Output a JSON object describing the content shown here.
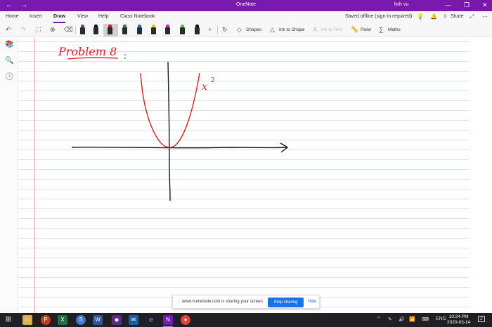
{
  "window": {
    "title": "OneNote",
    "user": "linh vu",
    "back_glyph": "←",
    "forward_glyph": "→",
    "minimize_glyph": "—",
    "restore_glyph": "❐",
    "close_glyph": "✕"
  },
  "menu": {
    "tabs": [
      "Home",
      "Insert",
      "Draw",
      "View",
      "Help",
      "Class Notebook"
    ],
    "active_tab": "Draw",
    "status": "Saved offline (sign-in required)",
    "share_label": "Share"
  },
  "toolbar": {
    "shapes_label": "Shapes",
    "ink_to_shape_label": "Ink to Shape",
    "ink_to_text_label": "Ink to Text",
    "ruler_label": "Ruler",
    "maths_label": "Maths",
    "pens": [
      {
        "name": "pen-purple-tip",
        "color": "#7b3f9e"
      },
      {
        "name": "pen-black",
        "color": "#111111"
      },
      {
        "name": "pen-red",
        "color": "#d11b1b"
      },
      {
        "name": "pen-green",
        "color": "#1f8f3a"
      },
      {
        "name": "pen-blue",
        "color": "#1b6fd1"
      },
      {
        "name": "pen-yellow",
        "color": "#f0c419"
      },
      {
        "name": "pen-magenta",
        "color": "#d21ab5"
      },
      {
        "name": "highlighter-green",
        "color": "#39d353"
      },
      {
        "name": "pen-black-2",
        "color": "#111111"
      }
    ],
    "selected_pen": "pen-red"
  },
  "notes": {
    "handwritten_title": "Problem 8",
    "curve_label": "x",
    "curve_exponent": "2",
    "ink_colors": {
      "title": "#d42020",
      "curve": "#d42020",
      "axes": "#1a1a1a"
    }
  },
  "share_bar": {
    "message": "www.numerade.com is sharing your screen.",
    "stop_label": "Stop sharing",
    "hide_label": "Hide"
  },
  "taskbar": {
    "language": "ENG",
    "time": "10:24 PM",
    "date": "2020-03-14",
    "notification_count": "2"
  }
}
